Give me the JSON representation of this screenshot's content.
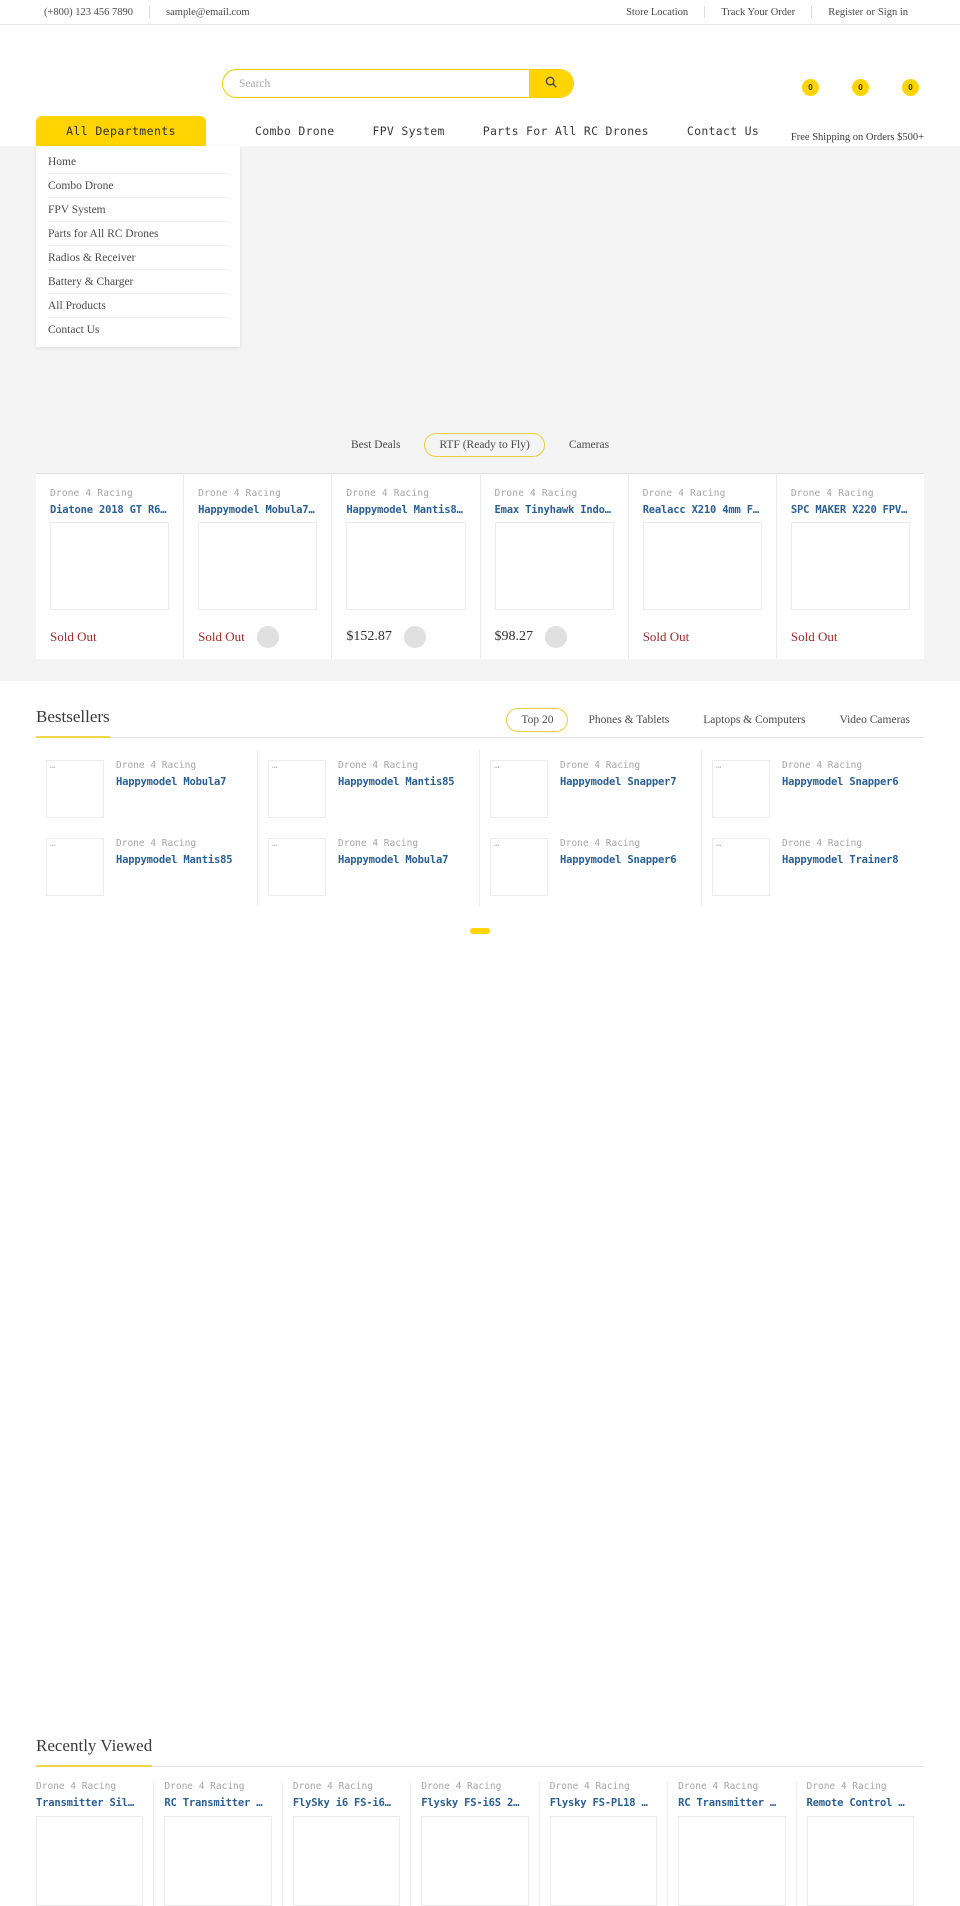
{
  "topbar": {
    "phone": "(+800) 123 456 7890",
    "email": "sample@email.com",
    "store_location": "Store Location",
    "track_order": "Track Your Order",
    "register": "Register",
    "or": "or",
    "signin": "Sign in"
  },
  "search": {
    "placeholder": "Search",
    "value": ""
  },
  "header_icons": [
    {
      "name": "compare-icon",
      "count": "0"
    },
    {
      "name": "wishlist-icon",
      "count": "0"
    },
    {
      "name": "cart-icon",
      "count": "0"
    }
  ],
  "nav": {
    "all_departments": "All Departments",
    "links": [
      "Combo Drone",
      "FPV System",
      "Parts For All RC Drones",
      "Contact Us"
    ],
    "free_shipping": "Free Shipping on Orders $500+"
  },
  "dropdown": {
    "items": [
      "Home",
      "Combo Drone",
      "FPV System",
      "Parts for All RC Drones",
      "Radios & Receiver",
      "Battery & Charger",
      "All Products",
      "Contact Us"
    ]
  },
  "deals": {
    "tabs": [
      {
        "label": "Best Deals",
        "active": false
      },
      {
        "label": "RTF (Ready to Fly)",
        "active": true
      },
      {
        "label": "Cameras",
        "active": false
      }
    ],
    "products": [
      {
        "brand": "Drone 4 Racing",
        "title": "Diatone 2018 GT R6…",
        "price": "",
        "status": "Sold Out",
        "has_cart": false
      },
      {
        "brand": "Drone 4 Racing",
        "title": "Happymodel Mobula7…",
        "price": "",
        "status": "Sold Out",
        "has_cart": true
      },
      {
        "brand": "Drone 4 Racing",
        "title": "Happymodel Mantis8…",
        "price": "$152.87",
        "status": "",
        "has_cart": true
      },
      {
        "brand": "Drone 4 Racing",
        "title": "Emax Tinyhawk Indo…",
        "price": "$98.27",
        "status": "",
        "has_cart": true
      },
      {
        "brand": "Drone 4 Racing",
        "title": "Realacc X210 4mm F…",
        "price": "",
        "status": "Sold Out",
        "has_cart": false
      },
      {
        "brand": "Drone 4 Racing",
        "title": "SPC MAKER X220 FPV…",
        "price": "",
        "status": "Sold Out",
        "has_cart": false
      }
    ]
  },
  "bestsellers": {
    "title": "Bestsellers",
    "tabs": [
      {
        "label": "Top 20",
        "active": true
      },
      {
        "label": "Phones & Tablets",
        "active": false
      },
      {
        "label": "Laptops & Computers",
        "active": false
      },
      {
        "label": "Video Cameras",
        "active": false
      }
    ],
    "items": [
      {
        "brand": "Drone 4 Racing",
        "title": "Happymodel Mobula7",
        "thumb": "…"
      },
      {
        "brand": "Drone 4 Racing",
        "title": "Happymodel Mantis85",
        "thumb": "…"
      },
      {
        "brand": "Drone 4 Racing",
        "title": "Happymodel Snapper7",
        "thumb": "…"
      },
      {
        "brand": "Drone 4 Racing",
        "title": "Happymodel Snapper6",
        "thumb": "…"
      },
      {
        "brand": "Drone 4 Racing",
        "title": "Happymodel Mantis85",
        "thumb": "…"
      },
      {
        "brand": "Drone 4 Racing",
        "title": "Happymodel Mobula7",
        "thumb": "…"
      },
      {
        "brand": "Drone 4 Racing",
        "title": "Happymodel Snapper6",
        "thumb": "…"
      },
      {
        "brand": "Drone 4 Racing",
        "title": "Happymodel Trainer8",
        "thumb": "…"
      }
    ]
  },
  "recently_viewed": {
    "title": "Recently Viewed",
    "items": [
      {
        "brand": "Drone 4 Racing",
        "title": "Transmitter Sil…"
      },
      {
        "brand": "Drone 4 Racing",
        "title": "RC Transmitter …"
      },
      {
        "brand": "Drone 4 Racing",
        "title": "FlySky i6 FS-i6…"
      },
      {
        "brand": "Drone 4 Racing",
        "title": "Flysky FS-i6S 2…"
      },
      {
        "brand": "Drone 4 Racing",
        "title": "Flysky FS-PL18 …"
      },
      {
        "brand": "Drone 4 Racing",
        "title": "RC Transmitter …"
      },
      {
        "brand": "Drone 4 Racing",
        "title": "Remote Control …"
      }
    ]
  },
  "colors": {
    "accent": "#ffd400",
    "link": "#2b5f92",
    "soldout": "#9c2b2b",
    "hero_bg": "#f4f4f4"
  }
}
